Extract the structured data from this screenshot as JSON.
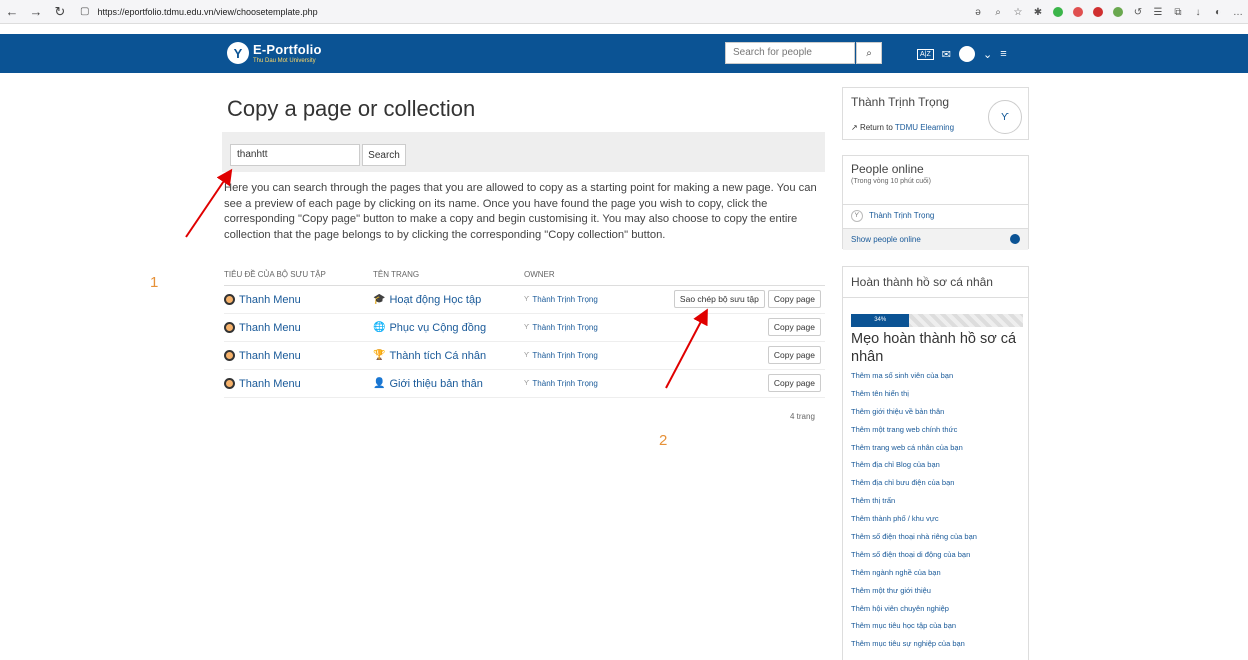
{
  "browser": {
    "url": "https://eportfolio.tdmu.edu.vn/view/choosetemplate.php"
  },
  "header": {
    "logo_title": "E-Portfolio",
    "logo_subtitle": "Thu Dau Mot University",
    "search_placeholder": "Search for people"
  },
  "main": {
    "title": "Copy a page or collection",
    "search_value": "thanhtt",
    "search_button": "Search",
    "description": "Here you can search through the pages that you are allowed to copy as a starting point for making a new page. You can see a preview of each page by clicking on its name. Once you have found the page you wish to copy, click the corresponding \"Copy page\" button to make a copy and begin customising it. You may also choose to copy the entire collection that the page belongs to by clicking the corresponding \"Copy collection\" button.",
    "columns": [
      "Tiêu đề của bộ sưu tập",
      "Tên trang",
      "Owner"
    ],
    "rows": [
      {
        "collection": "Thanh Menu",
        "page": "Hoạt động Học tập",
        "page_icon": "graduation-cap-icon",
        "owner": "Thành Trịnh Trọng",
        "copy_collection": "Sao chép bộ sưu tập",
        "copy_page": "Copy page"
      },
      {
        "collection": "Thanh Menu",
        "page": "Phục vụ Cộng đồng",
        "page_icon": "globe-icon",
        "owner": "Thành Trịnh Trọng",
        "copy_page": "Copy page"
      },
      {
        "collection": "Thanh Menu",
        "page": "Thành tích Cá nhân",
        "page_icon": "trophy-icon",
        "owner": "Thành Trịnh Trọng",
        "copy_page": "Copy page"
      },
      {
        "collection": "Thanh Menu",
        "page": "Giới thiệu bản thân",
        "page_icon": "person-icon",
        "owner": "Thành Trịnh Trọng",
        "copy_page": "Copy page"
      }
    ],
    "pages_count": "4 trang"
  },
  "annotations": {
    "label_1": "1",
    "label_2": "2",
    "color": "#e69138",
    "arrow_color": "#e00000"
  },
  "sidebar": {
    "user_name": "Thành Trịnh Trọng",
    "return_prefix": "Return to",
    "return_link": "TDMU Elearning",
    "online_title": "People online",
    "online_sub": "(Trong vòng 10 phút cuối)",
    "online_user": "Thành Trịnh Trọng",
    "show_online": "Show people online",
    "profile_title": "Hoàn thành hồ sơ cá nhân",
    "progress_percent": 34,
    "progress_label": "34%",
    "tips_title": "Mẹo hoàn thành hồ sơ cá nhân",
    "tips": [
      "Thêm ma số sinh viên của bạn",
      "Thêm tên hiển thị",
      "Thêm giới thiệu về bản thân",
      "Thêm một trang web chính thức",
      "Thêm trang web cá nhân của bạn",
      "Thêm địa chỉ Blog của bạn",
      "Thêm địa chỉ bưu điện của bạn",
      "Thêm thị trấn",
      "Thêm thành phố / khu vực",
      "Thêm số điện thoại nhà riêng của bạn",
      "Thêm số điện thoại di động của bạn",
      "Thêm ngành nghề của bạn",
      "Thêm một thư giới thiệu",
      "Thêm hội viên chuyên nghiệp",
      "Thêm mục tiêu học tập của bạn",
      "Thêm mục tiêu sự nghiệp của bạn"
    ],
    "brand_color": "#0b5394"
  }
}
